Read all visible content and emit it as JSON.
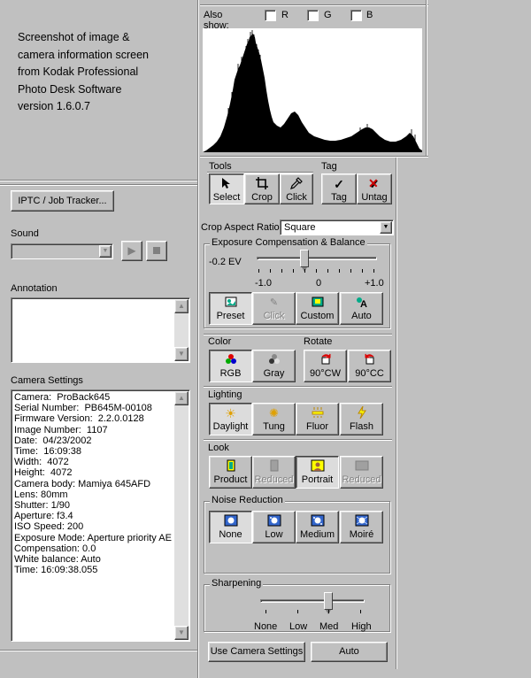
{
  "caption": {
    "lines": [
      "Screenshot of image &",
      "camera information screen",
      "from Kodak Professional",
      "Photo Desk Software",
      "version 1.6.0.7"
    ]
  },
  "also_show": {
    "label": "Also show:",
    "channels": [
      "R",
      "G",
      "B"
    ]
  },
  "left": {
    "iptc_button": "IPTC / Job Tracker...",
    "sound_label": "Sound",
    "sound_value": "",
    "annotation_label": "Annotation",
    "annotation_value": "",
    "camera_settings_label": "Camera Settings",
    "camera_settings_lines": [
      "Camera:  ProBack645",
      "Serial Number:  PB645M-00108",
      "Firmware Version:  2.2.0.0128",
      "Image Number:  1107",
      "Date:  04/23/2002",
      "Time:  16:09:38",
      "Width:  4072",
      "Height:  4072",
      "Camera body: Mamiya 645AFD",
      "Lens: 80mm",
      "Shutter: 1/90",
      "Aperture: f3.4",
      "ISO Speed: 200",
      "Exposure Mode: Aperture priority AE (A",
      "Compensation: 0.0",
      "White balance: Auto",
      "Time: 16:09:38.055"
    ]
  },
  "tools": {
    "label": "Tools",
    "items": [
      {
        "label": "Select",
        "icon": "arrow-icon",
        "state": "pressed"
      },
      {
        "label": "Crop",
        "icon": "crop-icon",
        "state": "normal"
      },
      {
        "label": "Click",
        "icon": "eyedropper-icon",
        "state": "normal"
      }
    ]
  },
  "tag": {
    "label": "Tag",
    "items": [
      {
        "label": "Tag",
        "icon": "checkmark-icon"
      },
      {
        "label": "Untag",
        "icon": "untag-icon"
      }
    ]
  },
  "crop_aspect": {
    "label": "Crop Aspect Ratio:",
    "value": "Square"
  },
  "exposure": {
    "label": "Exposure Compensation & Balance",
    "value_text": "-0.2 EV",
    "value": -0.2,
    "min_label": "-1.0",
    "mid_label": "0",
    "max_label": "+1.0",
    "buttons": [
      {
        "label": "Preset",
        "state": "pressed"
      },
      {
        "label": "Click",
        "state": "disabled"
      },
      {
        "label": "Custom",
        "state": "normal"
      },
      {
        "label": "Auto",
        "state": "normal"
      }
    ]
  },
  "color": {
    "label": "Color",
    "buttons": [
      {
        "label": "RGB",
        "state": "pressed"
      },
      {
        "label": "Gray",
        "state": "normal"
      }
    ]
  },
  "rotate": {
    "label": "Rotate",
    "buttons": [
      {
        "label": "90°CW"
      },
      {
        "label": "90°CC"
      }
    ]
  },
  "lighting": {
    "label": "Lighting",
    "buttons": [
      {
        "label": "Daylight",
        "state": "pressed"
      },
      {
        "label": "Tung",
        "state": "normal"
      },
      {
        "label": "Fluor",
        "state": "normal"
      },
      {
        "label": "Flash",
        "state": "normal"
      }
    ]
  },
  "look": {
    "label": "Look",
    "buttons": [
      {
        "label": "Product",
        "state": "normal"
      },
      {
        "label": "Reduced",
        "state": "disabled"
      },
      {
        "label": "Portrait",
        "state": "pressed"
      },
      {
        "label": "Reduced",
        "state": "disabled"
      }
    ]
  },
  "noise": {
    "label": "Noise Reduction",
    "buttons": [
      {
        "label": "None",
        "state": "pressed"
      },
      {
        "label": "Low",
        "state": "normal"
      },
      {
        "label": "Medium",
        "state": "normal"
      },
      {
        "label": "Moiré",
        "state": "normal"
      }
    ]
  },
  "sharpening": {
    "label": "Sharpening",
    "ticks": [
      "None",
      "Low",
      "Med",
      "High"
    ],
    "value": "Med"
  },
  "bottom_buttons": {
    "camera": "Use Camera Settings",
    "auto": "Auto"
  },
  "colors": {
    "background": "#c0c0c0",
    "histogram_bg": "#ffffff",
    "histogram_fill": "#000000",
    "tag_red": "#cc0000"
  }
}
